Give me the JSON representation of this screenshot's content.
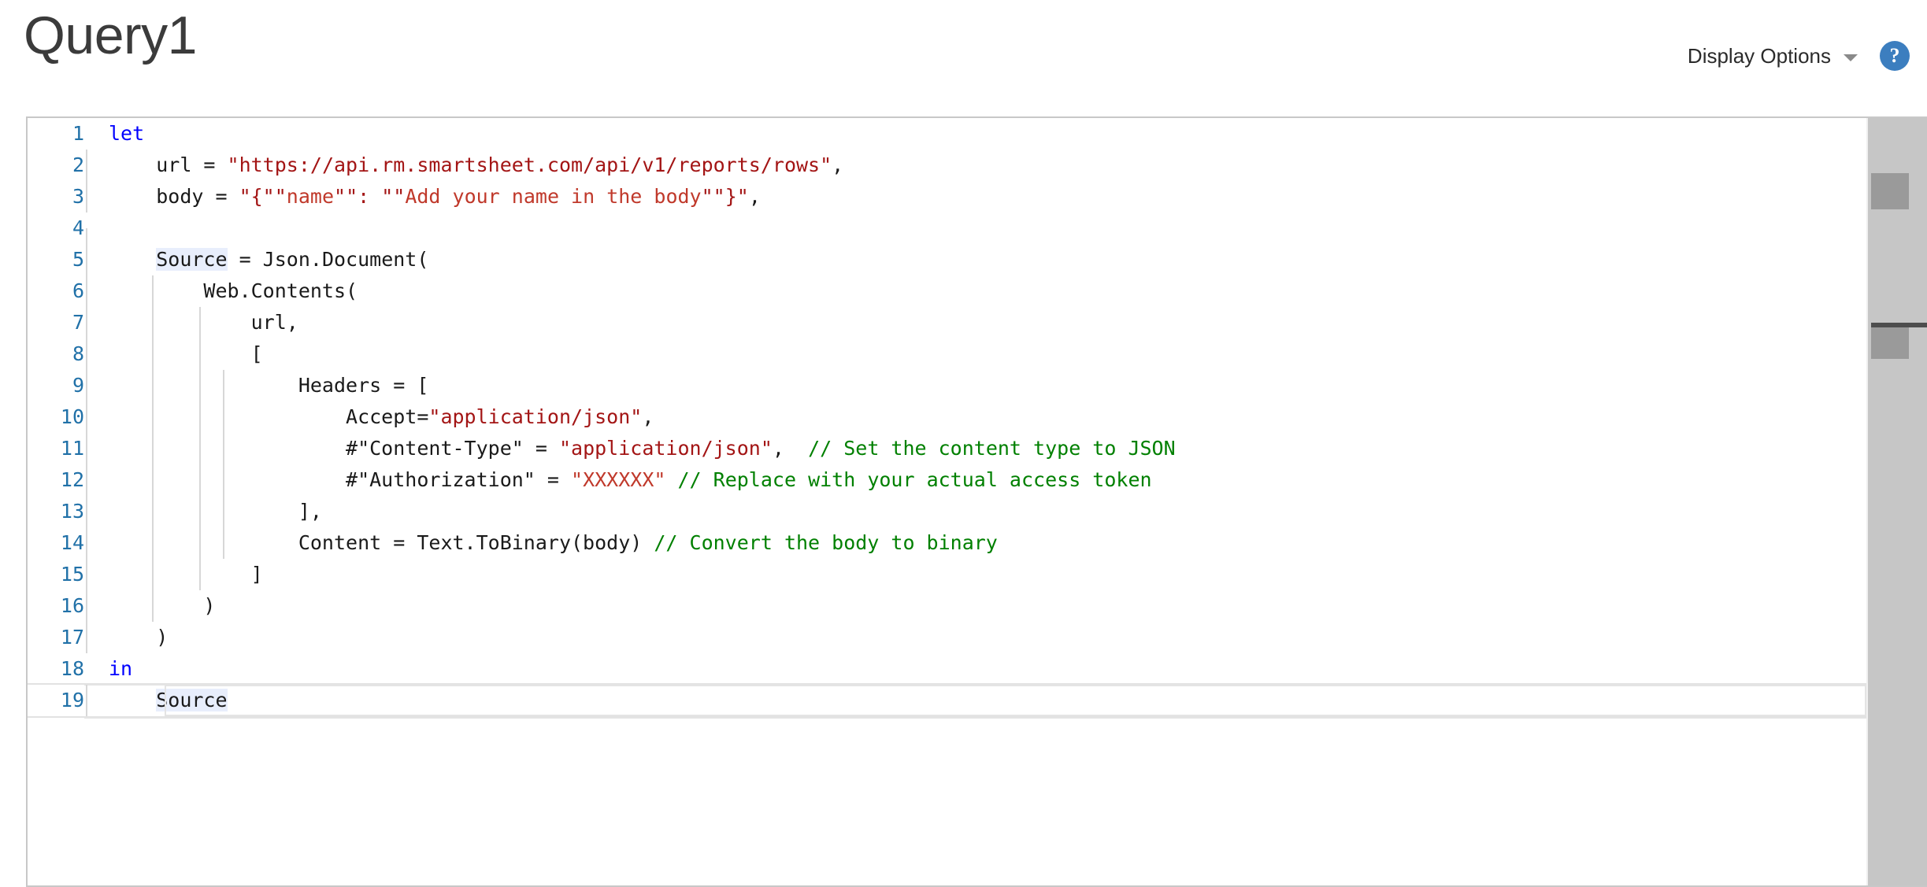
{
  "header": {
    "title": "Query1",
    "display_options_label": "Display Options",
    "caret_icon": "chevron-down-icon",
    "help_icon": "help-circle-icon",
    "help_glyph": "?",
    "accent_color": "#3c7ebf"
  },
  "editor": {
    "language": "Power Query M",
    "current_line": 19,
    "highlighted_token": "Source",
    "colors": {
      "keyword": "#0000ff",
      "string": "#a31515",
      "comment": "#008000",
      "line_number": "#2171a8",
      "text": "#1a1a1a",
      "token_highlight": "#e8eefc"
    },
    "lines": [
      {
        "n": "1",
        "text": "let"
      },
      {
        "n": "2",
        "text": "    url = \"https://api.rm.smartsheet.com/api/v1/reports/rows\","
      },
      {
        "n": "3",
        "text": "    body = \"{\"\"name\"\": \"\"Add your name in the body\"\"}\","
      },
      {
        "n": "4",
        "text": ""
      },
      {
        "n": "5",
        "text": "    Source = Json.Document("
      },
      {
        "n": "6",
        "text": "        Web.Contents("
      },
      {
        "n": "7",
        "text": "            url,"
      },
      {
        "n": "8",
        "text": "            ["
      },
      {
        "n": "9",
        "text": "                Headers = ["
      },
      {
        "n": "10",
        "text": "                    Accept=\"application/json\","
      },
      {
        "n": "11",
        "text": "                    #\"Content-Type\" = \"application/json\",  // Set the content type to JSON"
      },
      {
        "n": "12",
        "text": "                    #\"Authorization\" = \"XXXXXX\" // Replace with your actual access token"
      },
      {
        "n": "13",
        "text": "                ],"
      },
      {
        "n": "14",
        "text": "                Content = Text.ToBinary(body) // Convert the body to binary"
      },
      {
        "n": "15",
        "text": "            ]"
      },
      {
        "n": "16",
        "text": "        )"
      },
      {
        "n": "17",
        "text": "    )"
      },
      {
        "n": "18",
        "text": "in"
      },
      {
        "n": "19",
        "text": "    Source"
      }
    ]
  },
  "scrollbar": {
    "name": "vertical-scrollbar"
  }
}
